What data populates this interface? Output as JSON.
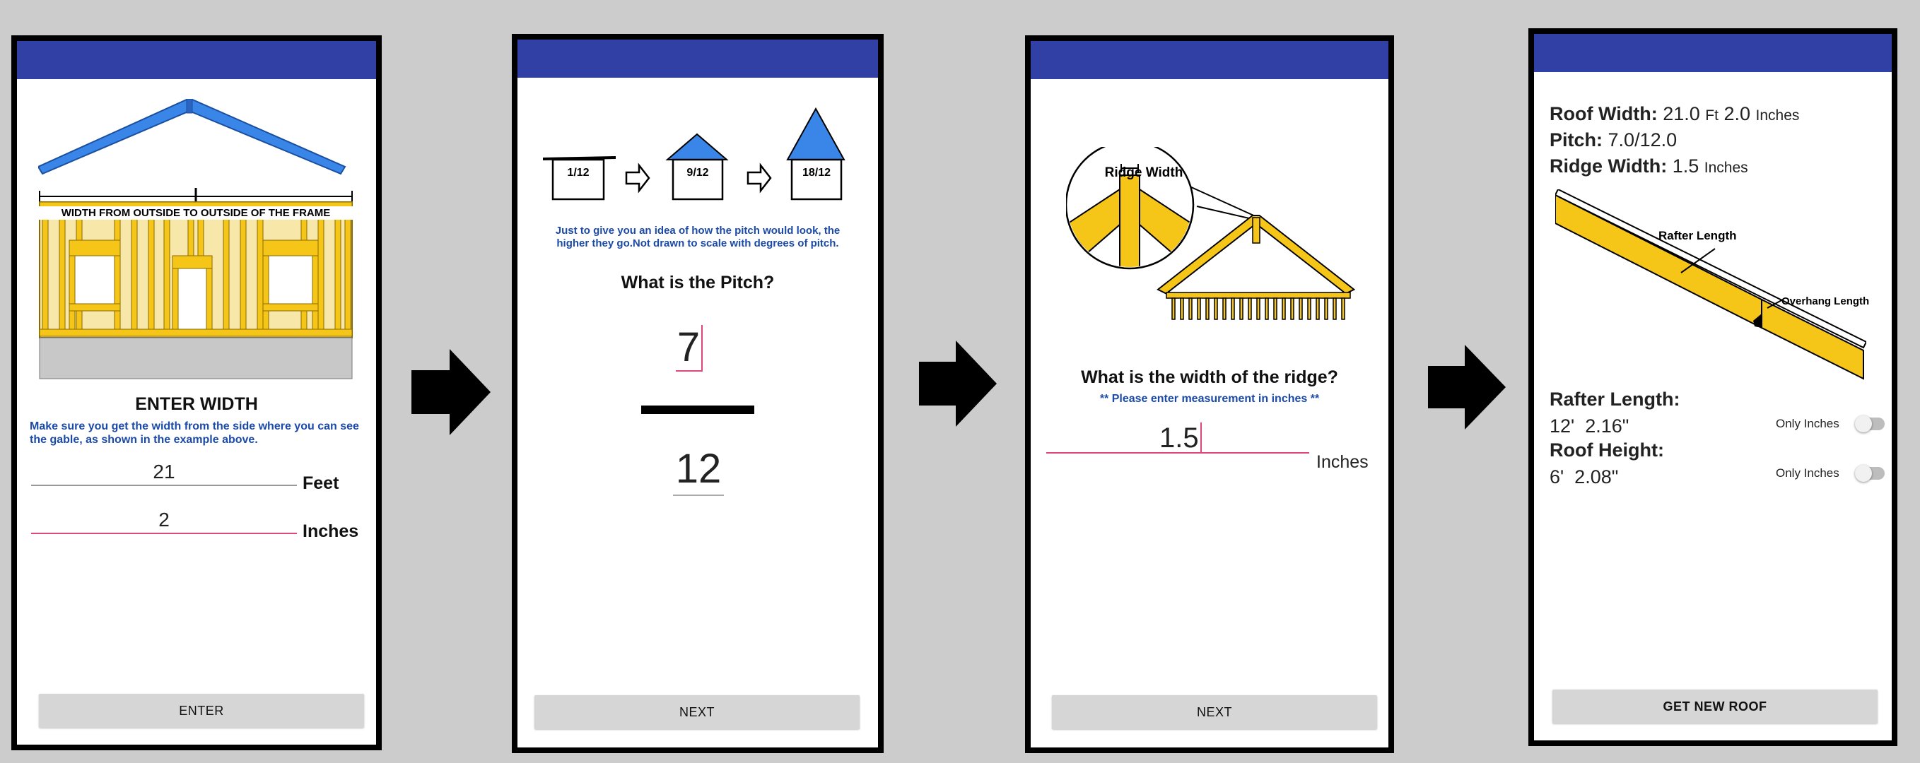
{
  "screens": [
    {
      "diagram_label": "WIDTH FROM OUTSIDE TO OUTSIDE OF THE FRAME",
      "title": "ENTER WIDTH",
      "instructions": "Make sure you get the width from the side where you can see the gable, as shown in the example above.",
      "feet_value": "21",
      "feet_unit": "Feet",
      "inches_value": "2",
      "inches_unit": "Inches",
      "button_label": "ENTER"
    },
    {
      "pitch_examples": [
        "1/12",
        "9/12",
        "18/12"
      ],
      "note": "Just to give you an idea of how the pitch would look, the higher they go.Not drawn to scale with degrees of pitch.",
      "question": "What is the Pitch?",
      "rise_value": "7",
      "run_value": "12",
      "button_label": "NEXT"
    },
    {
      "callout_label": "Ridge Width",
      "question": "What is the width of the ridge?",
      "note": "** Please enter measurement in inches **",
      "ridge_value": "1.5",
      "unit": "Inches",
      "button_label": "NEXT"
    },
    {
      "roof_width_label": "Roof Width:",
      "roof_width_ft": "21.0",
      "ft_unit": "Ft",
      "roof_width_in": "2.0",
      "in_unit": "Inches",
      "pitch_label": "Pitch:",
      "pitch_value": "7.0/12.0",
      "ridge_label": "Ridge Width:",
      "ridge_value": "1.5",
      "ridge_unit": "Inches",
      "rafter_diagram_label": "Rafter Length",
      "overhang_label": "Overhang Length",
      "rafter_length_label": "Rafter Length:",
      "rafter_length_value": "12'  2.16\"",
      "roof_height_label": "Roof Height:",
      "roof_height_value": "6'  2.08\"",
      "only_inches_label": "Only Inches",
      "button_label": "GET NEW ROOF"
    }
  ],
  "colors": {
    "appbar": "#3040a5",
    "accent_pink": "#e0457b",
    "roof_blue": "#3a86e8",
    "lumber_yellow": "#f5c518",
    "note_blue": "#1b4aa8"
  }
}
